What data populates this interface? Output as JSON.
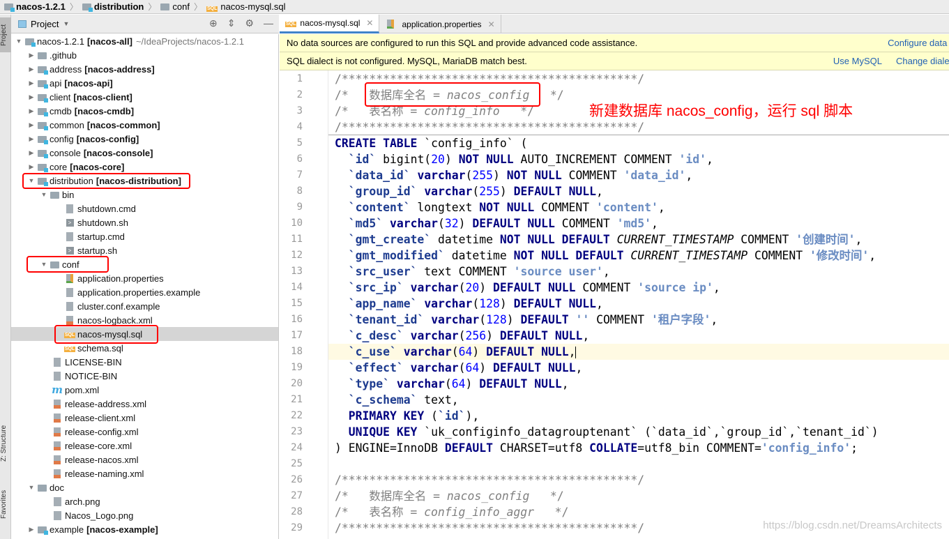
{
  "breadcrumb": [
    "nacos-1.2.1",
    "distribution",
    "conf",
    "nacos-mysql.sql"
  ],
  "sidebar": {
    "tabs": [
      "Project",
      "Z: Structure",
      "Favorites"
    ]
  },
  "project_panel": {
    "title": "Project",
    "tools": [
      "locate-icon",
      "collapse-icon",
      "gear-icon",
      "minimize-icon"
    ]
  },
  "tree": [
    {
      "level": 0,
      "arrow": "open",
      "icon": "module",
      "name": "nacos-1.2.1",
      "module": "[nacos-all]",
      "path": "~/IdeaProjects/nacos-1.2.1"
    },
    {
      "level": 1,
      "arrow": "closed",
      "icon": "folder",
      "name": ".github"
    },
    {
      "level": 1,
      "arrow": "closed",
      "icon": "module",
      "name": "address",
      "module": "[nacos-address]"
    },
    {
      "level": 1,
      "arrow": "closed",
      "icon": "module",
      "name": "api",
      "module": "[nacos-api]"
    },
    {
      "level": 1,
      "arrow": "closed",
      "icon": "module",
      "name": "client",
      "module": "[nacos-client]"
    },
    {
      "level": 1,
      "arrow": "closed",
      "icon": "module",
      "name": "cmdb",
      "module": "[nacos-cmdb]"
    },
    {
      "level": 1,
      "arrow": "closed",
      "icon": "module",
      "name": "common",
      "module": "[nacos-common]"
    },
    {
      "level": 1,
      "arrow": "closed",
      "icon": "module",
      "name": "config",
      "module": "[nacos-config]"
    },
    {
      "level": 1,
      "arrow": "closed",
      "icon": "module",
      "name": "console",
      "module": "[nacos-console]"
    },
    {
      "level": 1,
      "arrow": "closed",
      "icon": "module",
      "name": "core",
      "module": "[nacos-core]"
    },
    {
      "level": 1,
      "arrow": "open",
      "icon": "module",
      "name": "distribution",
      "module": "[nacos-distribution]"
    },
    {
      "level": 2,
      "arrow": "open",
      "icon": "folder",
      "name": "bin"
    },
    {
      "level": 4,
      "icon": "text",
      "name": "shutdown.cmd"
    },
    {
      "level": 4,
      "icon": "shell",
      "name": "shutdown.sh"
    },
    {
      "level": 4,
      "icon": "text",
      "name": "startup.cmd"
    },
    {
      "level": 4,
      "icon": "shell",
      "name": "startup.sh"
    },
    {
      "level": 2,
      "arrow": "open",
      "icon": "folder",
      "name": "conf"
    },
    {
      "level": 4,
      "icon": "properties",
      "name": "application.properties"
    },
    {
      "level": 4,
      "icon": "text",
      "name": "application.properties.example"
    },
    {
      "level": 4,
      "icon": "text",
      "name": "cluster.conf.example"
    },
    {
      "level": 4,
      "icon": "xml",
      "name": "nacos-logback.xml"
    },
    {
      "level": 4,
      "icon": "sql",
      "name": "nacos-mysql.sql",
      "selected": true
    },
    {
      "level": 4,
      "icon": "sql",
      "name": "schema.sql"
    },
    {
      "level": 3,
      "icon": "text",
      "name": "LICENSE-BIN"
    },
    {
      "level": 3,
      "icon": "text",
      "name": "NOTICE-BIN"
    },
    {
      "level": 3,
      "icon": "maven",
      "name": "pom.xml"
    },
    {
      "level": 3,
      "icon": "xml",
      "name": "release-address.xml"
    },
    {
      "level": 3,
      "icon": "xml",
      "name": "release-client.xml"
    },
    {
      "level": 3,
      "icon": "xml",
      "name": "release-config.xml"
    },
    {
      "level": 3,
      "icon": "xml",
      "name": "release-core.xml"
    },
    {
      "level": 3,
      "icon": "xml",
      "name": "release-nacos.xml"
    },
    {
      "level": 3,
      "icon": "xml",
      "name": "release-naming.xml"
    },
    {
      "level": 1,
      "arrow": "open",
      "icon": "folder",
      "name": "doc"
    },
    {
      "level": 3,
      "icon": "image",
      "name": "arch.png"
    },
    {
      "level": 3,
      "icon": "image",
      "name": "Nacos_Logo.png"
    },
    {
      "level": 1,
      "arrow": "closed",
      "icon": "module",
      "name": "example",
      "module": "[nacos-example]"
    }
  ],
  "tabs": [
    {
      "label": "nacos-mysql.sql",
      "icon": "sql",
      "active": true
    },
    {
      "label": "application.properties",
      "icon": "properties",
      "active": false
    }
  ],
  "banners": [
    {
      "text": "No data sources are configured to run this SQL and provide advanced code assistance.",
      "links": [
        "Configure data source"
      ]
    },
    {
      "text": "SQL dialect is not configured. MySQL, MariaDB match best.",
      "links": [
        "Use MySQL",
        "Change dialect to..."
      ]
    }
  ],
  "editor": {
    "current_line": 18,
    "lines": [
      [
        [
          "c",
          "/*******************************************/"
        ]
      ],
      [
        [
          "c",
          "/*   数据库全名 = "
        ],
        [
          "ci",
          "nacos_config"
        ],
        [
          "c",
          "   */"
        ]
      ],
      [
        [
          "c",
          "/*   表名称 = "
        ],
        [
          "ci",
          "config_info"
        ],
        [
          "c",
          "   */"
        ]
      ],
      [
        [
          "c",
          "/*******************************************/"
        ]
      ],
      [
        [
          "k",
          "CREATE TABLE"
        ],
        [
          "p",
          " `config_info` ("
        ]
      ],
      [
        [
          "p",
          "  "
        ],
        [
          "f",
          "`id`"
        ],
        [
          "p",
          " bigint("
        ],
        [
          "n",
          "20"
        ],
        [
          "p",
          ") "
        ],
        [
          "k",
          "NOT NULL"
        ],
        [
          "p",
          " AUTO_INCREMENT COMMENT "
        ],
        [
          "s",
          "'id'"
        ],
        [
          "p",
          ","
        ]
      ],
      [
        [
          "p",
          "  "
        ],
        [
          "f",
          "`data_id`"
        ],
        [
          "p",
          " "
        ],
        [
          "k",
          "varchar"
        ],
        [
          "p",
          "("
        ],
        [
          "n",
          "255"
        ],
        [
          "p",
          ") "
        ],
        [
          "k",
          "NOT NULL"
        ],
        [
          "p",
          " COMMENT "
        ],
        [
          "s",
          "'data_id'"
        ],
        [
          "p",
          ","
        ]
      ],
      [
        [
          "p",
          "  "
        ],
        [
          "f",
          "`group_id`"
        ],
        [
          "p",
          " "
        ],
        [
          "k",
          "varchar"
        ],
        [
          "p",
          "("
        ],
        [
          "n",
          "255"
        ],
        [
          "p",
          ") "
        ],
        [
          "k",
          "DEFAULT NULL"
        ],
        [
          "p",
          ","
        ]
      ],
      [
        [
          "p",
          "  "
        ],
        [
          "f",
          "`content`"
        ],
        [
          "p",
          " longtext "
        ],
        [
          "k",
          "NOT NULL"
        ],
        [
          "p",
          " COMMENT "
        ],
        [
          "s",
          "'content'"
        ],
        [
          "p",
          ","
        ]
      ],
      [
        [
          "p",
          "  "
        ],
        [
          "f",
          "`md5`"
        ],
        [
          "p",
          " "
        ],
        [
          "k",
          "varchar"
        ],
        [
          "p",
          "("
        ],
        [
          "n",
          "32"
        ],
        [
          "p",
          ") "
        ],
        [
          "k",
          "DEFAULT NULL"
        ],
        [
          "p",
          " COMMENT "
        ],
        [
          "s",
          "'md5'"
        ],
        [
          "p",
          ","
        ]
      ],
      [
        [
          "p",
          "  "
        ],
        [
          "f",
          "`gmt_create`"
        ],
        [
          "p",
          " datetime "
        ],
        [
          "k",
          "NOT NULL DEFAULT"
        ],
        [
          "p",
          " "
        ],
        [
          "i",
          "CURRENT_TIMESTAMP"
        ],
        [
          "p",
          " COMMENT "
        ],
        [
          "s",
          "'创建时间'"
        ],
        [
          "p",
          ","
        ]
      ],
      [
        [
          "p",
          "  "
        ],
        [
          "f",
          "`gmt_modified`"
        ],
        [
          "p",
          " datetime "
        ],
        [
          "k",
          "NOT NULL DEFAULT"
        ],
        [
          "p",
          " "
        ],
        [
          "i",
          "CURRENT_TIMESTAMP"
        ],
        [
          "p",
          " COMMENT "
        ],
        [
          "s",
          "'修改时间'"
        ],
        [
          "p",
          ","
        ]
      ],
      [
        [
          "p",
          "  "
        ],
        [
          "f",
          "`src_user`"
        ],
        [
          "p",
          " text COMMENT "
        ],
        [
          "s",
          "'source user'"
        ],
        [
          "p",
          ","
        ]
      ],
      [
        [
          "p",
          "  "
        ],
        [
          "f",
          "`src_ip`"
        ],
        [
          "p",
          " "
        ],
        [
          "k",
          "varchar"
        ],
        [
          "p",
          "("
        ],
        [
          "n",
          "20"
        ],
        [
          "p",
          ") "
        ],
        [
          "k",
          "DEFAULT NULL"
        ],
        [
          "p",
          " COMMENT "
        ],
        [
          "s",
          "'source ip'"
        ],
        [
          "p",
          ","
        ]
      ],
      [
        [
          "p",
          "  "
        ],
        [
          "f",
          "`app_name`"
        ],
        [
          "p",
          " "
        ],
        [
          "k",
          "varchar"
        ],
        [
          "p",
          "("
        ],
        [
          "n",
          "128"
        ],
        [
          "p",
          ") "
        ],
        [
          "k",
          "DEFAULT NULL"
        ],
        [
          "p",
          ","
        ]
      ],
      [
        [
          "p",
          "  "
        ],
        [
          "f",
          "`tenant_id`"
        ],
        [
          "p",
          " "
        ],
        [
          "k",
          "varchar"
        ],
        [
          "p",
          "("
        ],
        [
          "n",
          "128"
        ],
        [
          "p",
          ") "
        ],
        [
          "k",
          "DEFAULT"
        ],
        [
          "p",
          " "
        ],
        [
          "s",
          "''"
        ],
        [
          "p",
          " COMMENT "
        ],
        [
          "s",
          "'租户字段'"
        ],
        [
          "p",
          ","
        ]
      ],
      [
        [
          "p",
          "  "
        ],
        [
          "f",
          "`c_desc`"
        ],
        [
          "p",
          " "
        ],
        [
          "k",
          "varchar"
        ],
        [
          "p",
          "("
        ],
        [
          "n",
          "256"
        ],
        [
          "p",
          ") "
        ],
        [
          "k",
          "DEFAULT NULL"
        ],
        [
          "p",
          ","
        ]
      ],
      [
        [
          "p",
          "  "
        ],
        [
          "f",
          "`c_use`"
        ],
        [
          "p",
          " "
        ],
        [
          "k",
          "varchar"
        ],
        [
          "p",
          "("
        ],
        [
          "n",
          "64"
        ],
        [
          "p",
          ") "
        ],
        [
          "k",
          "DEFAULT NULL"
        ],
        [
          "p",
          ","
        ]
      ],
      [
        [
          "p",
          "  "
        ],
        [
          "f",
          "`effect`"
        ],
        [
          "p",
          " "
        ],
        [
          "k",
          "varchar"
        ],
        [
          "p",
          "("
        ],
        [
          "n",
          "64"
        ],
        [
          "p",
          ") "
        ],
        [
          "k",
          "DEFAULT NULL"
        ],
        [
          "p",
          ","
        ]
      ],
      [
        [
          "p",
          "  "
        ],
        [
          "f",
          "`type`"
        ],
        [
          "p",
          " "
        ],
        [
          "k",
          "varchar"
        ],
        [
          "p",
          "("
        ],
        [
          "n",
          "64"
        ],
        [
          "p",
          ") "
        ],
        [
          "k",
          "DEFAULT NULL"
        ],
        [
          "p",
          ","
        ]
      ],
      [
        [
          "p",
          "  "
        ],
        [
          "f",
          "`c_schema`"
        ],
        [
          "p",
          " text,"
        ]
      ],
      [
        [
          "p",
          "  "
        ],
        [
          "k",
          "PRIMARY KEY"
        ],
        [
          "p",
          " ("
        ],
        [
          "f",
          "`id`"
        ],
        [
          "p",
          "),"
        ]
      ],
      [
        [
          "p",
          "  "
        ],
        [
          "k",
          "UNIQUE KEY"
        ],
        [
          "p",
          " `uk_configinfo_datagrouptenant` (`data_id`,`group_id`,`tenant_id`)"
        ]
      ],
      [
        [
          "p",
          ") ENGINE=InnoDB "
        ],
        [
          "k",
          "DEFAULT"
        ],
        [
          "p",
          " CHARSET=utf8 "
        ],
        [
          "k",
          "COLLATE"
        ],
        [
          "p",
          "=utf8_bin COMMENT="
        ],
        [
          "s",
          "'config_info'"
        ],
        [
          "p",
          ";"
        ]
      ],
      [],
      [
        [
          "c",
          "/*******************************************/"
        ]
      ],
      [
        [
          "c",
          "/*   数据库全名 = "
        ],
        [
          "ci",
          "nacos_config"
        ],
        [
          "c",
          "   */"
        ]
      ],
      [
        [
          "c",
          "/*   表名称 = "
        ],
        [
          "ci",
          "config_info_aggr"
        ],
        [
          "c",
          "   */"
        ]
      ],
      [
        [
          "c",
          "/*******************************************/"
        ]
      ]
    ]
  },
  "annotation": "新建数据库 nacos_config，运行 sql 脚本",
  "watermark": "https://blog.csdn.net/DreamsArchitects",
  "colors": {
    "highlight_box": "#ff0000",
    "banner_bg": "#ffffcc",
    "keyword": "#000080",
    "link": "#2261b4"
  }
}
